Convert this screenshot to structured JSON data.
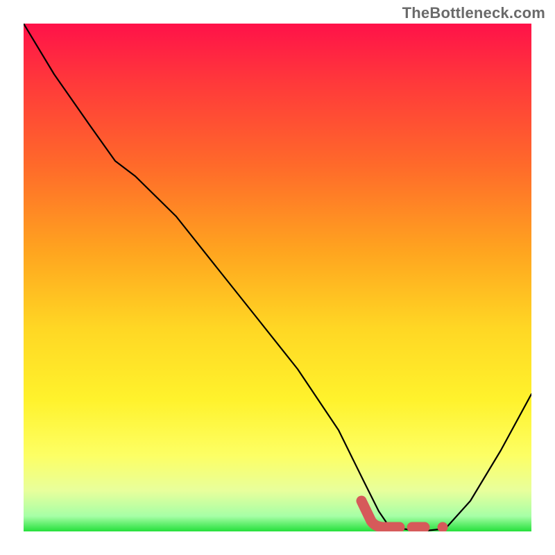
{
  "watermark": "TheBottleneck.com",
  "colors": {
    "gradient_top": "#ff1249",
    "gradient_mid": "#ffd724",
    "gradient_bottom": "#25e03c",
    "curve_stroke": "#000000",
    "compat_marker": "#d65a5a",
    "watermark_text": "#6a6a6a"
  },
  "chart_data": {
    "type": "line",
    "title": "",
    "xlabel": "",
    "ylabel": "",
    "xlim": [
      0,
      100
    ],
    "ylim": [
      0,
      100
    ],
    "note": "Bottleneck heat-map background with single black compatibility curve. Axis values are not labeled; x and y are treated as 0–100 percent of plot area. Lower y = better (valley = compatible zone).",
    "series": [
      {
        "name": "bottleneck_curve",
        "color": "#000000",
        "points": [
          {
            "x": 0.0,
            "y": 100.0
          },
          {
            "x": 6.0,
            "y": 90.0
          },
          {
            "x": 13.0,
            "y": 80.0
          },
          {
            "x": 18.0,
            "y": 73.0
          },
          {
            "x": 22.0,
            "y": 70.0
          },
          {
            "x": 30.0,
            "y": 62.0
          },
          {
            "x": 38.0,
            "y": 52.0
          },
          {
            "x": 46.0,
            "y": 42.0
          },
          {
            "x": 54.0,
            "y": 32.0
          },
          {
            "x": 62.0,
            "y": 20.0
          },
          {
            "x": 67.0,
            "y": 10.0
          },
          {
            "x": 70.0,
            "y": 4.0
          },
          {
            "x": 72.0,
            "y": 1.0
          },
          {
            "x": 78.0,
            "y": 0.0
          },
          {
            "x": 83.0,
            "y": 0.5
          },
          {
            "x": 88.0,
            "y": 6.0
          },
          {
            "x": 94.0,
            "y": 16.0
          },
          {
            "x": 100.0,
            "y": 27.0
          }
        ]
      }
    ],
    "compatibility_markers": {
      "name": "highlighted_compatible_range",
      "color": "#d65a5a",
      "description": "Thick coral L-shaped marker plus dash and dot near valley floor indicating selected compatible hardware range.",
      "points": [
        {
          "x": 66.5,
          "y": 6.0
        },
        {
          "x": 68.5,
          "y": 2.0
        },
        {
          "x": 72.0,
          "y": 0.8
        },
        {
          "x": 76.0,
          "y": 0.8
        },
        {
          "x": 79.0,
          "y": 0.8
        },
        {
          "x": 82.5,
          "y": 0.8
        }
      ]
    }
  }
}
